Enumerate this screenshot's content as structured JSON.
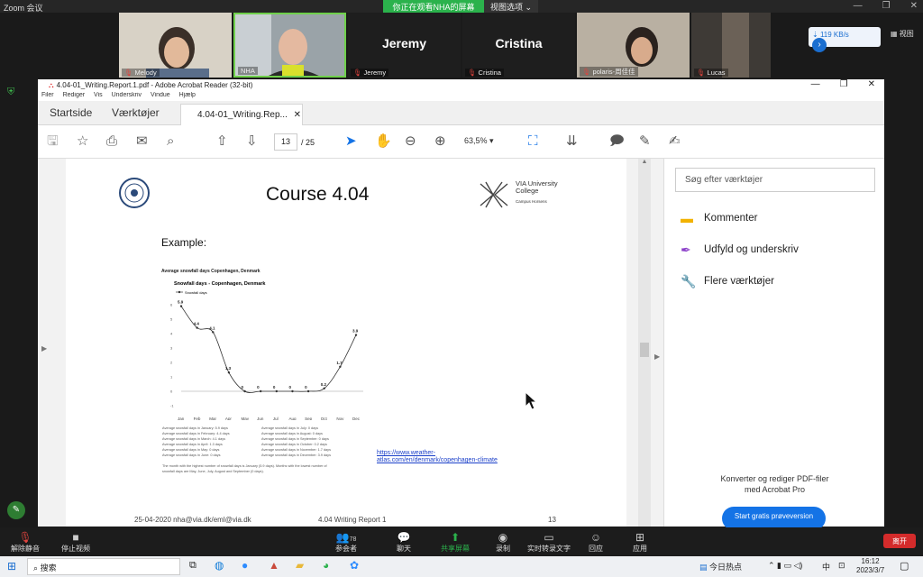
{
  "zoom": {
    "title": "Zoom 会议",
    "share_banner": "你正在观看NHA的屏幕",
    "view_options": "视图选项",
    "speed": "119 KB/s",
    "view_label": "视图",
    "participants": [
      {
        "name": "Melody",
        "type": "video"
      },
      {
        "name": "NHA",
        "type": "video"
      },
      {
        "name": "Jeremy",
        "type": "name",
        "display": "Jeremy"
      },
      {
        "name": "Cristina",
        "type": "name",
        "display": "Cristina"
      },
      {
        "name": "polaris-周佳佳",
        "type": "video"
      },
      {
        "name": "Lucas",
        "type": "video"
      }
    ],
    "controls": {
      "unmute": "解除静音",
      "start_video": "停止视频",
      "participants": "参会者",
      "participants_count": "78",
      "chat": "聊天",
      "share": "共享屏幕",
      "record": "录制",
      "captions": "实时转录文字",
      "reactions": "回应",
      "apps": "应用",
      "leave": "离开"
    }
  },
  "acrobat": {
    "window_title": "4.04-01_Writing.Report.1.pdf - Adobe Acrobat Reader (32-bit)",
    "menu": [
      "Filer",
      "Rediger",
      "Vis",
      "Underskriv",
      "Vindue",
      "Hjælp"
    ],
    "tabs": {
      "home": "Startside",
      "tools": "Værktøjer",
      "doc": "4.04-01_Writing.Rep..."
    },
    "toolbar": {
      "page_current": "13",
      "page_total": "/ 25",
      "zoom": "63,5%"
    },
    "right_pane": {
      "search_placeholder": "Søg efter værktøjer",
      "tools": [
        "Kommenter",
        "Udfyld og underskriv",
        "Flere værktøjer"
      ],
      "promo_line1": "Konverter og rediger PDF-filer",
      "promo_line2": "med Acrobat Pro",
      "trial_button": "Start gratis prøveversion"
    }
  },
  "pdf": {
    "course_title": "Course 4.04",
    "logo_name": "VIA University",
    "logo_name2": "College",
    "logo_sub": "Campus Horsens",
    "example": "Example:",
    "link_line1": "https://www.weather-",
    "link_line2": "atlas.com/en/denmark/copenhagen-climate",
    "footer_left": "25-04-2020  nha@via.dk/eml@via.dk",
    "footer_center": "4.04 Writing Report 1",
    "footer_page": "13",
    "stats_left": [
      "Average snowfall days in January: 5.9 days",
      "Average snowfall days in February: 4.4 days",
      "Average snowfall days in March: 4.1 days",
      "Average snowfall days in April: 1.3 days",
      "Average snowfall days in May: 0 days",
      "Average snowfall days in June: 0 days"
    ],
    "stats_right": [
      "Average snowfall days in July: 0 days",
      "Average snowfall days in August: 0 days",
      "Average snowfall days in September: 0 days",
      "Average snowfall days in October: 0.2 days",
      "Average snowfall days in November: 1.7 days",
      "Average snowfall days in December: 3.9 days"
    ],
    "summary1": "The month with the highest number of snowfall days is January (5.9 days). Months with the lowest number of",
    "summary2": "snowfall days are May, June, July, August and September (0 days)."
  },
  "chart_data": {
    "type": "line",
    "title": "Snowfall days - Copenhagen, Denmark",
    "heading": "Average snowfall days Copenhagen, Denmark",
    "categories": [
      "Jan",
      "Feb",
      "Mar",
      "Apr",
      "May",
      "Jun",
      "Jul",
      "Aug",
      "Sep",
      "Oct",
      "Nov",
      "Dec"
    ],
    "series": [
      {
        "name": "Snowfall days",
        "values": [
          5.9,
          4.4,
          4.1,
          1.3,
          0,
          0,
          0,
          0,
          0,
          0.2,
          1.7,
          3.9
        ]
      }
    ],
    "ylim": [
      -1,
      6
    ],
    "yticks": [
      "6",
      "5",
      "4",
      "3",
      "2",
      "1",
      "0",
      "-1"
    ]
  },
  "taskbar": {
    "search": "搜索",
    "news": "今日热点",
    "ime": "中",
    "time": "16:12",
    "date": "2023/3/7"
  }
}
